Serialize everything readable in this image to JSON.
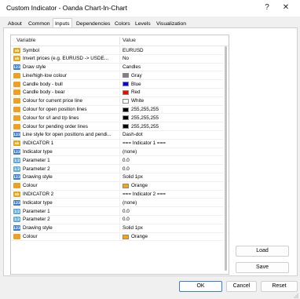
{
  "window": {
    "title": "Custom Indicator - Oanda Chart-In-Chart",
    "help_glyph": "?",
    "close_glyph": "✕"
  },
  "tabs": [
    {
      "label": "About",
      "active": false
    },
    {
      "label": "Common",
      "active": false
    },
    {
      "label": "Inputs",
      "active": true
    },
    {
      "label": "Dependencies",
      "active": false
    },
    {
      "label": "Colors",
      "active": false
    },
    {
      "label": "Levels",
      "active": false
    },
    {
      "label": "Visualization",
      "active": false
    }
  ],
  "grid": {
    "headers": {
      "variable": "Variable",
      "value": "Value"
    },
    "rows": [
      {
        "icon": "abc",
        "icon_text": "ab",
        "name": "Symbol",
        "value": "EURUSD"
      },
      {
        "icon": "bool",
        "icon_text": "ab",
        "name": "Invert prices (e.g. EURUSD -> USDE...",
        "value": "No"
      },
      {
        "icon": "enum",
        "icon_text": "123",
        "name": "Draw style",
        "value": "Candles"
      },
      {
        "icon": "col",
        "icon_text": "",
        "name": "Line/high-low colour",
        "value": "Gray",
        "swatch": "#808080"
      },
      {
        "icon": "col",
        "icon_text": "",
        "name": "Candle body - bull",
        "value": "Blue",
        "swatch": "#0000ff"
      },
      {
        "icon": "col",
        "icon_text": "",
        "name": "Candle body - bear",
        "value": "Red",
        "swatch": "#ff0000"
      },
      {
        "icon": "col",
        "icon_text": "",
        "name": "Colour for current price line",
        "value": "White",
        "swatch": "#ffffff"
      },
      {
        "icon": "col",
        "icon_text": "",
        "name": "Colour for open position lines",
        "value": "255,255,255",
        "swatch": "#000000"
      },
      {
        "icon": "col",
        "icon_text": "",
        "name": "Colour for s/l and t/p lines",
        "value": "255,255,255",
        "swatch": "#000000"
      },
      {
        "icon": "col",
        "icon_text": "",
        "name": "Colour for pending order lines",
        "value": "255,255,255",
        "swatch": "#000000"
      },
      {
        "icon": "enum",
        "icon_text": "123",
        "name": "Line style for open positions and pendi...",
        "value": "Dash-dot"
      },
      {
        "icon": "abc",
        "icon_text": "ab",
        "name": "INDICATOR 1",
        "value": "=== Indicator 1 ==="
      },
      {
        "icon": "enum",
        "icon_text": "123",
        "name": "Indicator type",
        "value": "(none)"
      },
      {
        "icon": "real",
        "icon_text": "1/2",
        "name": "Parameter 1",
        "value": "0.0"
      },
      {
        "icon": "real",
        "icon_text": "1/2",
        "name": "Parameter 2",
        "value": "0.0"
      },
      {
        "icon": "enum",
        "icon_text": "123",
        "name": "Drawing style",
        "value": "Solid 1px"
      },
      {
        "icon": "col",
        "icon_text": "",
        "name": "Colour",
        "value": "Orange",
        "swatch": "#ffa500"
      },
      {
        "icon": "abc",
        "icon_text": "ab",
        "name": "INDICATOR 2",
        "value": "=== Indicator 2 ==="
      },
      {
        "icon": "enum",
        "icon_text": "123",
        "name": "Indicator type",
        "value": "(none)"
      },
      {
        "icon": "real",
        "icon_text": "1/2",
        "name": "Parameter 1",
        "value": "0.0"
      },
      {
        "icon": "real",
        "icon_text": "1/2",
        "name": "Parameter 2",
        "value": "0.0"
      },
      {
        "icon": "enum",
        "icon_text": "123",
        "name": "Drawing style",
        "value": "Solid 1px"
      },
      {
        "icon": "col",
        "icon_text": "",
        "name": "Colour",
        "value": "Orange",
        "swatch": "#ffa500"
      }
    ]
  },
  "side_buttons": {
    "load": "Load",
    "save": "Save"
  },
  "footer_buttons": {
    "ok": "OK",
    "cancel": "Cancel",
    "reset": "Reset"
  },
  "colors": {
    "accent": "#3a7bd5"
  }
}
